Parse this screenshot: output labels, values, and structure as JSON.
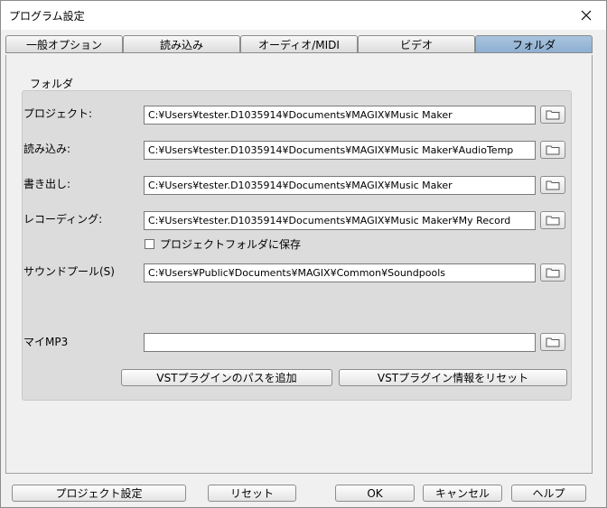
{
  "window": {
    "title": "プログラム設定"
  },
  "tabs": [
    {
      "label": "一般オプション"
    },
    {
      "label": "読み込み"
    },
    {
      "label": "オーディオ/MIDI"
    },
    {
      "label": "ビデオ"
    },
    {
      "label": "フォルダ",
      "active": true
    }
  ],
  "group": {
    "title": "フォルダ"
  },
  "folders": [
    {
      "label": "プロジェクト:",
      "path": "C:¥Users¥tester.D1035914¥Documents¥MAGIX¥Music Maker"
    },
    {
      "label": "読み込み:",
      "path": "C:¥Users¥tester.D1035914¥Documents¥MAGIX¥Music Maker¥AudioTemp"
    },
    {
      "label": "書き出し:",
      "path": "C:¥Users¥tester.D1035914¥Documents¥MAGIX¥Music Maker"
    },
    {
      "label": "レコーディング:",
      "path": "C:¥Users¥tester.D1035914¥Documents¥MAGIX¥Music Maker¥My Record"
    },
    {
      "label": "サウンドプール(S)",
      "path": "C:¥Users¥Public¥Documents¥MAGIX¥Common¥Soundpools"
    },
    {
      "label": "マイMP3",
      "path": ""
    }
  ],
  "checkbox": {
    "label": "プロジェクトフォルダに保存",
    "checked": false
  },
  "vst_buttons": {
    "add_path": "VSTプラグインのパスを追加",
    "reset_info": "VSTプラグイン情報をリセット"
  },
  "footer": {
    "project_settings": "プロジェクト設定",
    "reset": "リセット",
    "ok": "OK",
    "cancel": "キャンセル",
    "help": "ヘルプ"
  },
  "icons": {
    "close": "close-icon",
    "browse": "folder-icon"
  }
}
